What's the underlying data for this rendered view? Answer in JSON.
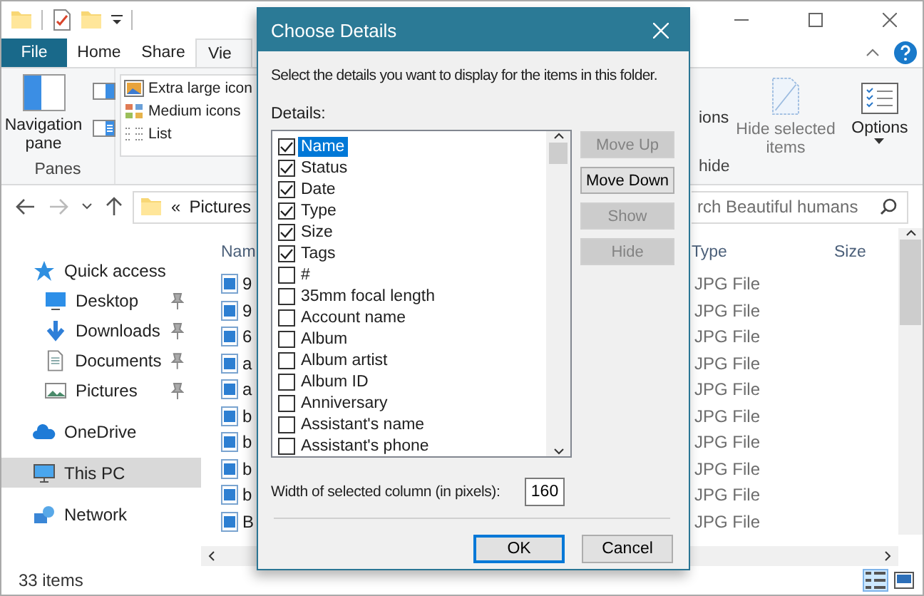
{
  "ribbon_tabs": [
    {
      "label": "File",
      "kind": "file",
      "selected": false
    },
    {
      "label": "Home",
      "kind": "tab",
      "selected": false
    },
    {
      "label": "Share",
      "kind": "tab",
      "selected": false
    },
    {
      "label": "Vie",
      "kind": "tab",
      "selected": true
    }
  ],
  "ribbon": {
    "navigation_pane": "Navigation pane",
    "panes_label": "Panes",
    "layout_items": [
      {
        "label": "Extra large icon",
        "kind": "xl"
      },
      {
        "label": "Medium icons",
        "kind": "medium"
      },
      {
        "label": "List",
        "kind": "list"
      }
    ],
    "view_fragment": "ions",
    "hide_selected_items": "Hide selected items",
    "options": "Options",
    "group_fragment": "hide"
  },
  "address": {
    "separator": "«",
    "location": "Pictures"
  },
  "search": {
    "placeholder": "rch Beautiful humans"
  },
  "navigation": [
    {
      "label": "Quick access",
      "kind": "star",
      "selected": false,
      "children": [
        {
          "label": "Desktop",
          "kind": "desktop",
          "pinned": true,
          "selected": false
        },
        {
          "label": "Downloads",
          "kind": "download",
          "pinned": true,
          "selected": false
        },
        {
          "label": "Documents",
          "kind": "document",
          "pinned": true,
          "selected": false
        },
        {
          "label": "Pictures",
          "kind": "picture",
          "pinned": true,
          "selected": false
        }
      ]
    },
    {
      "label": "OneDrive",
      "kind": "cloud",
      "selected": false
    },
    {
      "label": "This PC",
      "kind": "computer",
      "selected": true
    },
    {
      "label": "Network",
      "kind": "network",
      "selected": false
    }
  ],
  "file_list": {
    "columns": [
      "Nam",
      "Type",
      "Size"
    ],
    "rows": [
      {
        "name": "9",
        "type": "JPG File"
      },
      {
        "name": "9",
        "type": "JPG File"
      },
      {
        "name": "6",
        "type": "JPG File"
      },
      {
        "name": "a",
        "type": "JPG File"
      },
      {
        "name": "a",
        "type": "JPG File"
      },
      {
        "name": "b",
        "type": "JPG File"
      },
      {
        "name": "b",
        "type": "JPG File"
      },
      {
        "name": "b",
        "type": "JPG File"
      },
      {
        "name": "b",
        "type": "JPG File"
      },
      {
        "name": "B",
        "type": "JPG File"
      }
    ]
  },
  "status_bar": {
    "item_count": "33 items",
    "views": [
      {
        "kind": "details",
        "selected": true
      },
      {
        "kind": "large_icons",
        "selected": false
      }
    ]
  },
  "dialog": {
    "title": "Choose Details",
    "instruction": "Select the details you want to display for the items in this folder.",
    "details_label": "Details:",
    "details": [
      {
        "label": "Name",
        "checked": true,
        "selected": true
      },
      {
        "label": "Status",
        "checked": true,
        "selected": false
      },
      {
        "label": "Date",
        "checked": true,
        "selected": false
      },
      {
        "label": "Type",
        "checked": true,
        "selected": false
      },
      {
        "label": "Size",
        "checked": true,
        "selected": false
      },
      {
        "label": "Tags",
        "checked": true,
        "selected": false
      },
      {
        "label": "#",
        "checked": false,
        "selected": false
      },
      {
        "label": "35mm focal length",
        "checked": false,
        "selected": false
      },
      {
        "label": "Account name",
        "checked": false,
        "selected": false
      },
      {
        "label": "Album",
        "checked": false,
        "selected": false
      },
      {
        "label": "Album artist",
        "checked": false,
        "selected": false
      },
      {
        "label": "Album ID",
        "checked": false,
        "selected": false
      },
      {
        "label": "Anniversary",
        "checked": false,
        "selected": false
      },
      {
        "label": "Assistant's name",
        "checked": false,
        "selected": false
      },
      {
        "label": "Assistant's phone",
        "checked": false,
        "selected": false
      }
    ],
    "buttons": [
      {
        "label": "Move Up",
        "disabled": true
      },
      {
        "label": "Move Down",
        "disabled": false
      },
      {
        "label": "Show",
        "disabled": true
      },
      {
        "label": "Hide",
        "disabled": true
      }
    ],
    "width_label": "Width of selected column (in pixels):",
    "width_value": "160",
    "actions": [
      {
        "label": "OK",
        "default": true
      },
      {
        "label": "Cancel",
        "default": false
      }
    ]
  }
}
